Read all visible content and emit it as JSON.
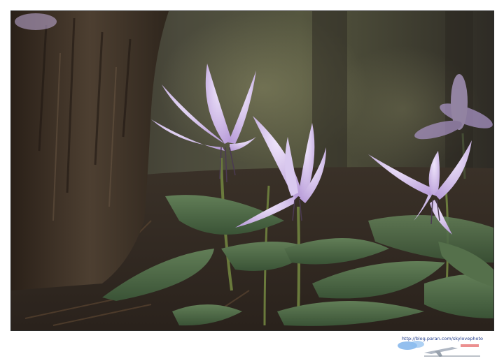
{
  "image": {
    "alt": "Close-up photo of purple dogtooth violet flowers growing near a tree trunk on a forest floor"
  },
  "watermark": {
    "url_text": "http://blog.paran.com/skylovephoto",
    "logo": "skylovephoto-logo"
  },
  "colors": {
    "frame_border": "#2a2a2a",
    "petal": "#c8b2e6",
    "leaf": "#4f6b47",
    "url_text": "#1e3a8a"
  }
}
